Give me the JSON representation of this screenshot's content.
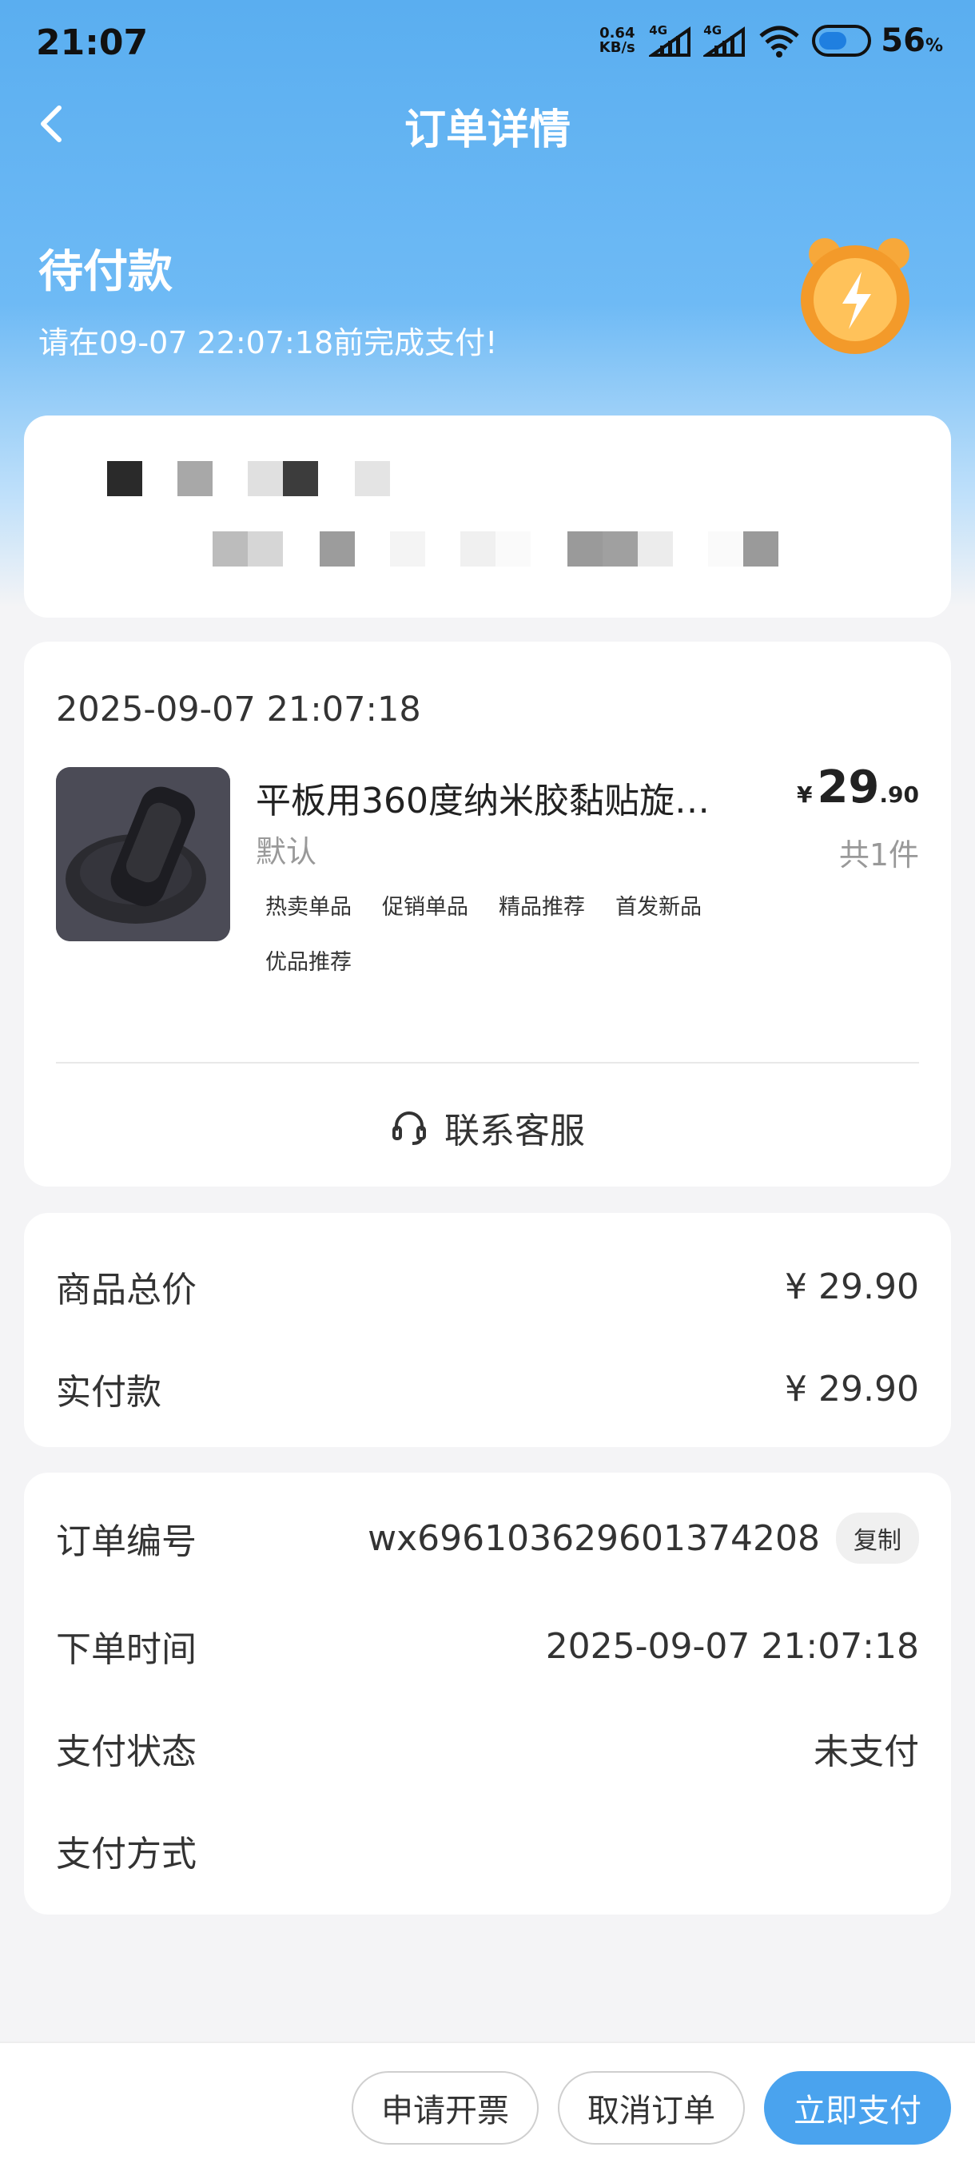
{
  "status_bar": {
    "time": "21:07",
    "net_speed_value": "0.64",
    "net_speed_unit": "KB/s",
    "signal_1": "4G",
    "signal_2": "4G",
    "battery_level": "56",
    "battery_unit": "%"
  },
  "nav": {
    "title": "订单详情"
  },
  "order_status": {
    "title": "待付款",
    "subtitle": "请在09-07 22:07:18前完成支付!"
  },
  "product_card": {
    "order_time": "2025-09-07 21:07:18",
    "product_name": "平板用360度纳米胶黏贴旋…",
    "spec": "默认",
    "price_currency": "¥",
    "price_integer": "29",
    "price_decimal": ".90",
    "quantity": "共1件",
    "tags": [
      "热卖单品",
      "促销单品",
      "精品推荐",
      "首发新品",
      "优品推荐"
    ],
    "contact_label": "联系客服"
  },
  "totals": {
    "goods_total_label": "商品总价",
    "goods_total_value": "¥ 29.90",
    "paid_label": "实付款",
    "paid_value": "¥ 29.90"
  },
  "order_info": {
    "order_no_label": "订单编号",
    "order_no_value": "wx696103629601374208",
    "copy_label": "复制",
    "order_time_label": "下单时间",
    "order_time_value": "2025-09-07 21:07:18",
    "pay_status_label": "支付状态",
    "pay_status_value": "未支付",
    "pay_method_label": "支付方式",
    "pay_method_value": ""
  },
  "bottom_bar": {
    "invoice_label": "申请开票",
    "cancel_label": "取消订单",
    "pay_label": "立即支付"
  },
  "colors": {
    "header_blue": "#5aaef0",
    "primary_button": "#4aa3ee",
    "page_background": "#f4f4f6"
  }
}
